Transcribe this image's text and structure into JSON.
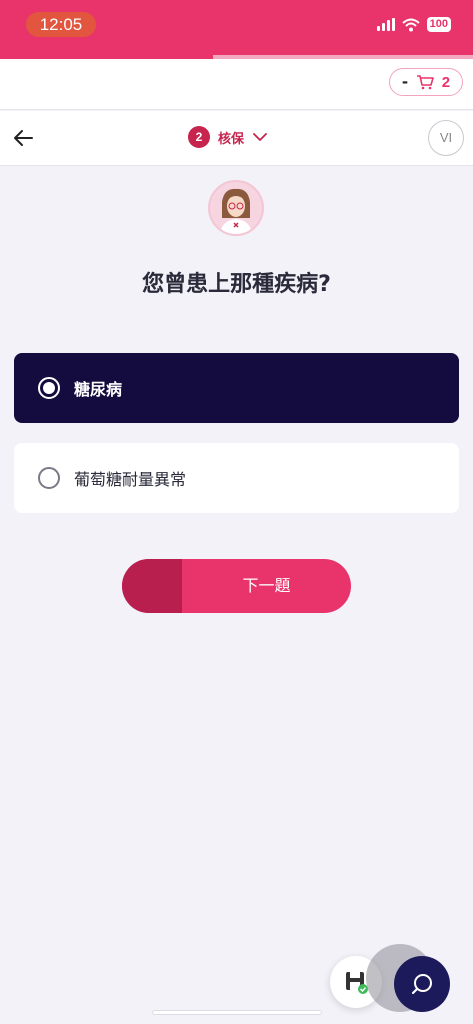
{
  "status_bar": {
    "time": "12:05",
    "battery": "100"
  },
  "progress": {
    "fraction": 0.45
  },
  "cart": {
    "minus_label": "-",
    "count": "2"
  },
  "header": {
    "step_number": "2",
    "step_label": "核保",
    "user_initials": "VI"
  },
  "question": {
    "text": "您曾患上那種疾病?"
  },
  "options": [
    {
      "label": "糖尿病",
      "selected": true
    },
    {
      "label": "葡萄糖耐量異常",
      "selected": false
    }
  ],
  "next_button": {
    "label": "下一題"
  },
  "colors": {
    "brand": "#e9336b",
    "navy": "#140c3f",
    "background": "#f3f2f8"
  },
  "icons": [
    "back-arrow-icon",
    "cart-icon",
    "chevron-down-icon",
    "wifi-icon",
    "signal-icon",
    "save-icon",
    "chat-icon"
  ]
}
